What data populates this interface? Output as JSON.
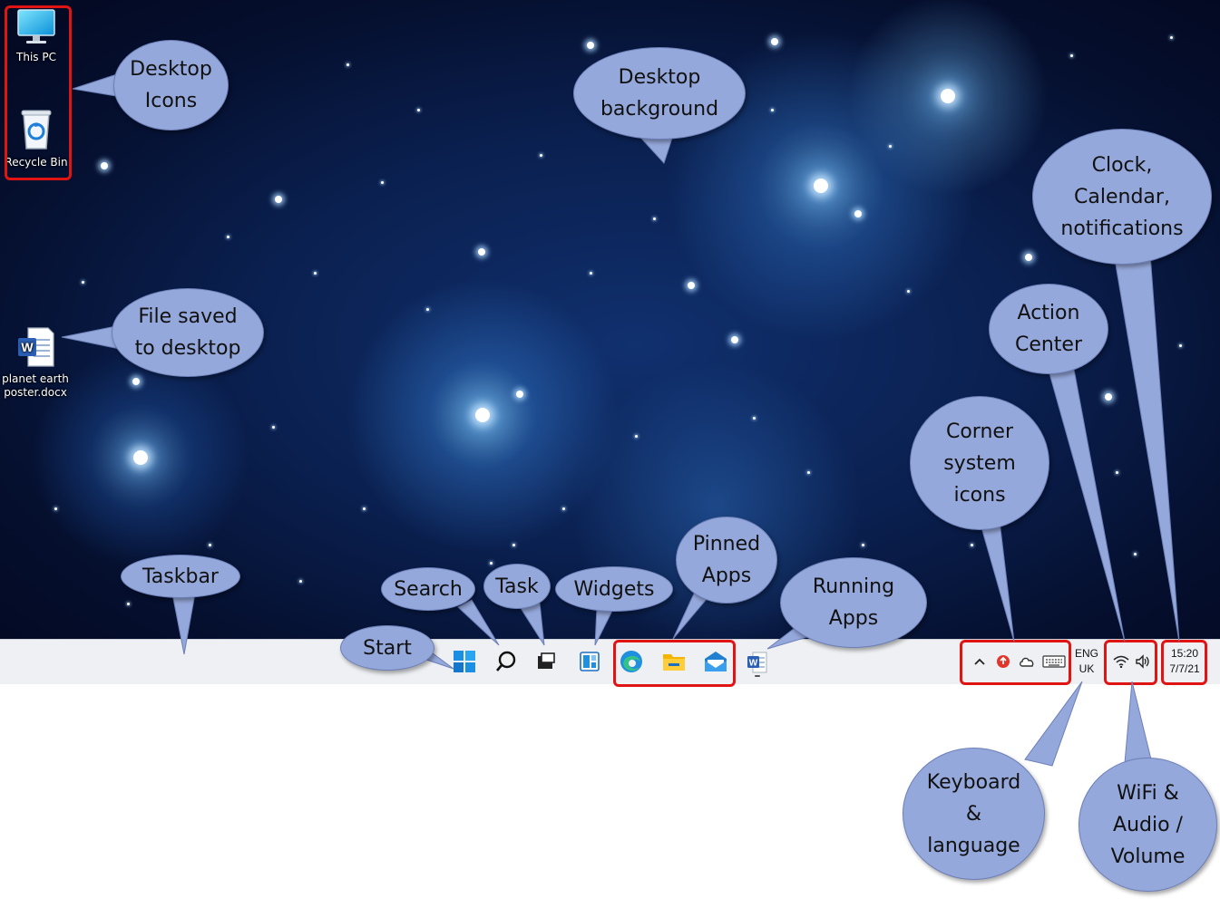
{
  "desktop": {
    "icons": [
      {
        "label": "This PC",
        "icon": "monitor-icon"
      },
      {
        "label": "Recycle Bin",
        "icon": "recycle-bin-icon"
      },
      {
        "label": "planet earth\nposter.docx",
        "icon": "word-document-icon"
      }
    ],
    "background_colors": {
      "deep": "#050f2e",
      "nebula": "#2f7fd8"
    }
  },
  "callouts": {
    "desktop_icons": "Desktop\nIcons",
    "desktop_background": "Desktop\nbackground",
    "clock": "Clock,\nCalendar,\nnotifications",
    "file_saved": "File saved\nto desktop",
    "action_center": "Action\nCenter",
    "corner_icons": "Corner\nsystem\nicons",
    "taskbar": "Taskbar",
    "search": "Search",
    "task": "Task",
    "widgets": "Widgets",
    "pinned_apps": "Pinned\nApps",
    "running_apps": "Running\nApps",
    "start": "Start",
    "keyboard": "Keyboard\n&\nlanguage",
    "wifi": "WiFi &\nAudio /\nVolume"
  },
  "taskbar": {
    "items": [
      "start-button",
      "search-button",
      "task-view-button",
      "widgets-button",
      "edge-icon",
      "file-explorer-icon",
      "mail-icon",
      "word-icon"
    ],
    "tray": {
      "lang_top": "ENG",
      "lang_bottom": "UK",
      "time": "15:20",
      "date": "7/7/21"
    }
  },
  "colors": {
    "callout_fill": "#95a8db",
    "highlight_red": "#e11414",
    "taskbar_bg": "#eef0f3"
  }
}
